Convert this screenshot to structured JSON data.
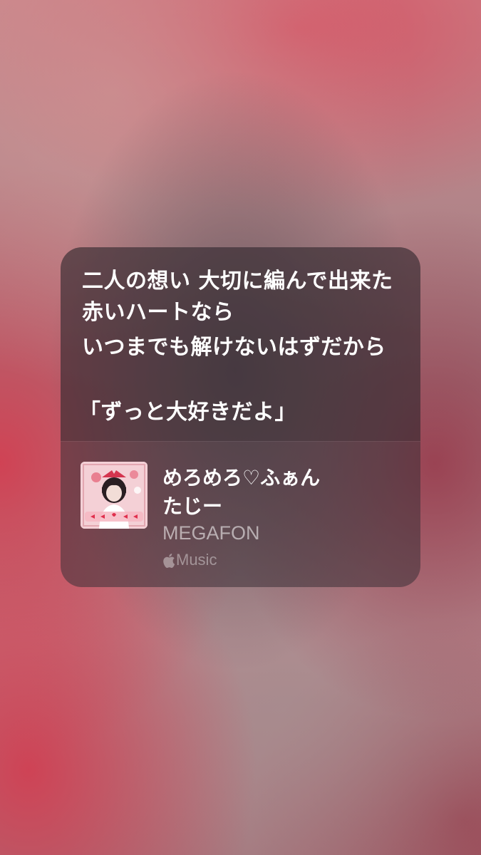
{
  "lyrics": {
    "line1": "二人の想い 大切に編んで出来た赤いハートなら",
    "line2": "いつまでも解けないはずだから",
    "line3": "「ずっと大好きだよ」"
  },
  "track": {
    "title": "めろめろ♡ふぁん",
    "artist": "たじー",
    "album": "MEGAFON"
  },
  "service": {
    "icon": "apple-icon",
    "label": "Music"
  },
  "colors": {
    "background_accent": "#d6455a",
    "card_tint": "#3a3036",
    "text_primary": "#ffffff",
    "text_secondary": "#b9aeb2"
  }
}
